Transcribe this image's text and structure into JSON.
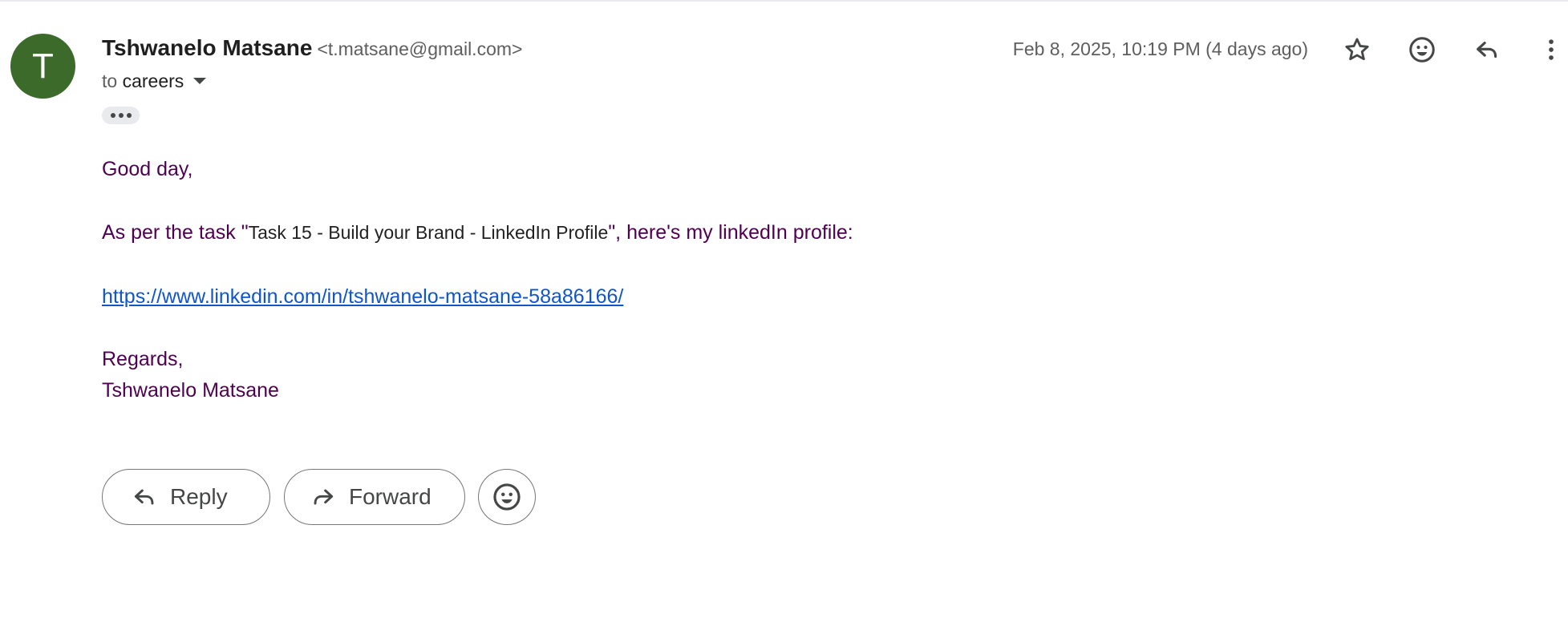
{
  "sender": {
    "avatar_letter": "T",
    "avatar_color": "#3c6a2b",
    "name": "Tshwanelo Matsane",
    "email": "<t.matsane@gmail.com>"
  },
  "recipient": {
    "prefix": "to",
    "name": "careers"
  },
  "date": "Feb 8, 2025, 10:19 PM (4 days ago)",
  "header_icons": [
    "star-icon",
    "emoji-icon",
    "reply-icon",
    "more-vert-icon"
  ],
  "body": {
    "greeting": "Good day,",
    "line_prefix": "As per the task \"",
    "line_quoted": "Task 15 - Build your Brand - LinkedIn Profile",
    "line_suffix": "\", here's my linkedIn profile:",
    "link": "https://www.linkedin.com/in/tshwanelo-matsane-58a86166/",
    "signoff": "Regards,",
    "signature": "Tshwanelo Matsane"
  },
  "actions": {
    "reply_label": "Reply",
    "forward_label": "Forward"
  },
  "colors": {
    "body_text": "#500050",
    "link": "#1155cc",
    "icon": "#444746"
  }
}
